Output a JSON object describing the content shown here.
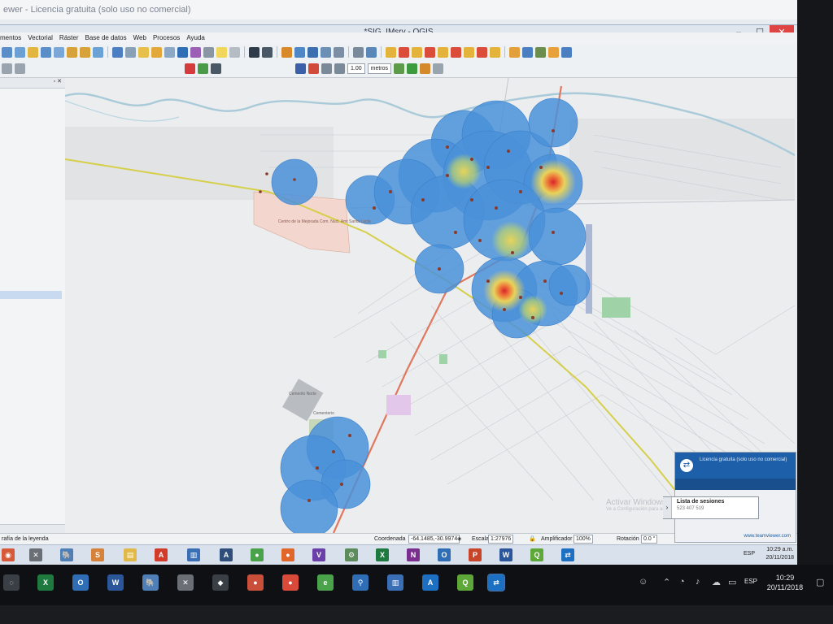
{
  "host_window": {
    "title": "ewer - Licencia gratuita (solo uso no comercial)"
  },
  "qgis": {
    "title": "*SIG_IMsrv - QGIS",
    "window_controls": [
      "–",
      "☐",
      "✕"
    ],
    "menu": [
      "mentos",
      "Vectorial",
      "Ráster",
      "Base de datos",
      "Web",
      "Procesos",
      "Ayuda"
    ],
    "snapping": {
      "tolerance": "1.00",
      "units": "metros"
    },
    "legend_hint": "rafía de la leyenda"
  },
  "statusbar": {
    "coord_label": "Coordenada",
    "coord_value": "-64.1485,-30.9974",
    "scale_label": "Escala",
    "scale_value": "1:27976",
    "magnifier_label": "Amplificador",
    "magnifier_value": "100%",
    "rotation_label": "Rotación",
    "rotation_value": "0.0 °"
  },
  "map": {
    "labels": {
      "area1": "Centro de la Mejorada Com. Nucl. Amt Santa Lucía",
      "area2": "Cemento Norte",
      "area3": "Cementerio"
    },
    "colors": {
      "heat_low": "#4a90d9",
      "heat_mid": "#e8d35a",
      "heat_high": "#d9242a",
      "road_main": "#e0785f",
      "road_secondary": "#d6cf4a"
    }
  },
  "teamviewer": {
    "notice": "Licencia gratuita (solo uso no comercial)",
    "sessions_title": "Lista de sesiones",
    "session_id": "523 407 519",
    "link": "www.teamviewer.com",
    "watermark_line1": "Activar Windows",
    "watermark_line2": "Ve a Configuración para activar Windows."
  },
  "remote_taskbar": {
    "lang": "ESP",
    "time": "10:29 a.m.",
    "date": "20/11/2018"
  },
  "host_taskbar": {
    "lang": "ESP",
    "time": "10:29",
    "date": "20/11/2018"
  }
}
